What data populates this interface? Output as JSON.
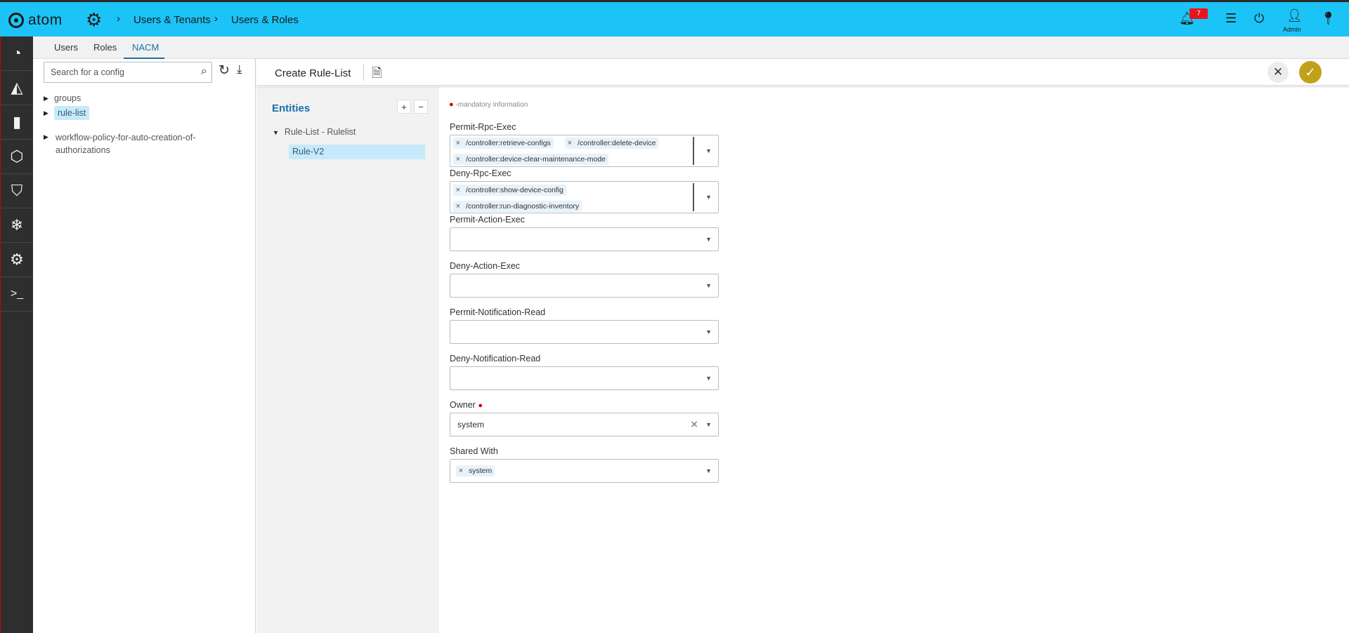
{
  "topbar": {
    "logo_text": "atom",
    "breadcrumbs": [
      "Users & Tenants",
      "Users & Roles"
    ],
    "notification_count": "7",
    "user_label": "Admin"
  },
  "tabs": [
    {
      "label": "Users"
    },
    {
      "label": "Roles"
    },
    {
      "label": "NACM"
    }
  ],
  "tree": {
    "search_placeholder": "Search for a config",
    "items": [
      {
        "label": "groups"
      },
      {
        "label": "rule-list"
      },
      {
        "label": "workflow-policy-for-auto-creation-of-",
        "label_line2": "authorizations"
      }
    ]
  },
  "form": {
    "title": "Create Rule-List"
  },
  "entities": {
    "title": "Entities",
    "node_label": "Rule-List - Rulelist",
    "child_label": "Rule-V2"
  },
  "fields": {
    "mandatory_note": "-mandatory information",
    "permit_rpc_exec": {
      "label": "Permit-Rpc-Exec",
      "chips": [
        "/controller:retrieve-configs",
        "/controller:delete-device",
        "/controller:device-clear-maintenance-mode"
      ]
    },
    "deny_rpc_exec": {
      "label": "Deny-Rpc-Exec",
      "chips": [
        "/controller:show-device-config",
        "/controller:run-diagnostic-inventory"
      ]
    },
    "permit_action_exec": {
      "label": "Permit-Action-Exec"
    },
    "deny_action_exec": {
      "label": "Deny-Action-Exec"
    },
    "permit_notification_read": {
      "label": "Permit-Notification-Read"
    },
    "deny_notification_read": {
      "label": "Deny-Notification-Read"
    },
    "owner": {
      "label": "Owner",
      "value": "system"
    },
    "shared_with": {
      "label": "Shared With",
      "chips": [
        "system"
      ]
    }
  },
  "colors": {
    "topbar": "#1cc3f7",
    "rail": "#2e2e2e",
    "accent": "#1a6fa8",
    "confirm": "#c2a11a",
    "badge": "#e8141c"
  }
}
